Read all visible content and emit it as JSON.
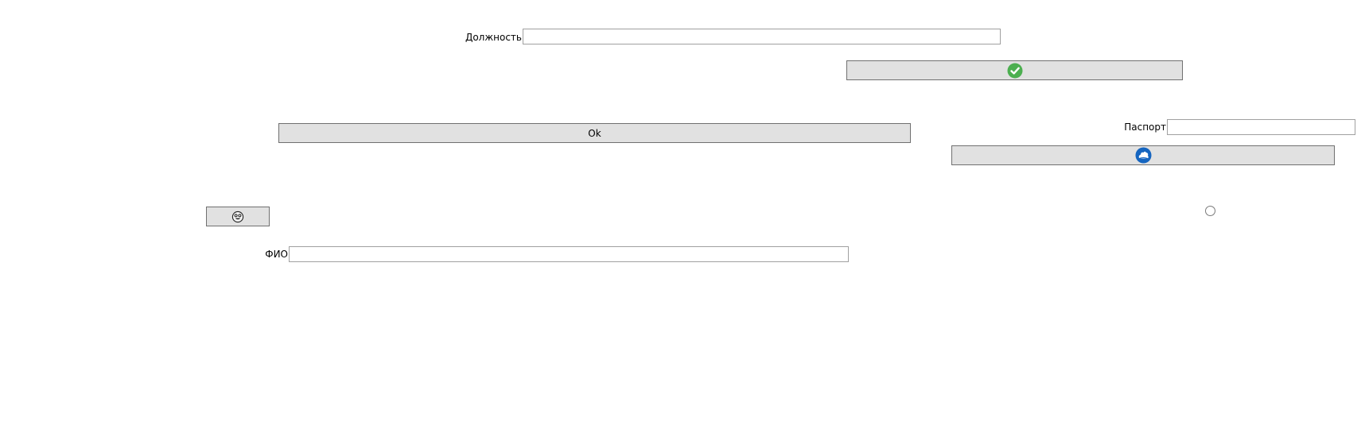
{
  "form": {
    "position_label": "Должность",
    "position_value": "",
    "passport_label": "Паспорт",
    "passport_value": "",
    "fio_label": "ФИО",
    "fio_value": "",
    "ok_label": "Ok",
    "confirm_icon": "green-checkmark-icon",
    "cloud_icon": "blue-cloud-circle-icon",
    "smiley_icon": "smiley-face-icon",
    "radio_checked": false
  },
  "colors": {
    "button_bg": "#e1e1e1",
    "button_border": "#707070",
    "field_border": "#a0a0a0",
    "check_green": "#4caf50",
    "cloud_blue": "#1565c0"
  }
}
